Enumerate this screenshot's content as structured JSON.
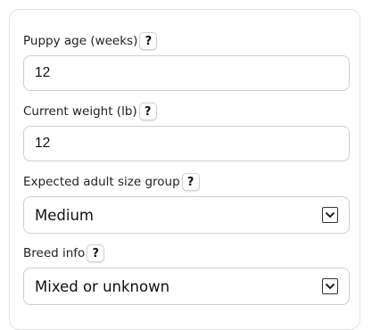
{
  "form": {
    "puppy_age": {
      "label": "Puppy age (weeks)",
      "help": "?",
      "value": "12"
    },
    "current_weight": {
      "label": "Current weight (lb)",
      "help": "?",
      "value": "12"
    },
    "adult_size": {
      "label": "Expected adult size group",
      "help": "?",
      "value": "Medium"
    },
    "breed_info": {
      "label": "Breed info",
      "help": "?",
      "value": "Mixed or unknown"
    }
  },
  "icons": {
    "help": "question-mark-icon",
    "dropdown": "chevron-down-icon"
  },
  "colors": {
    "border": "#cfcfcf",
    "card_border": "#e3e3e3",
    "text": "#222222"
  }
}
